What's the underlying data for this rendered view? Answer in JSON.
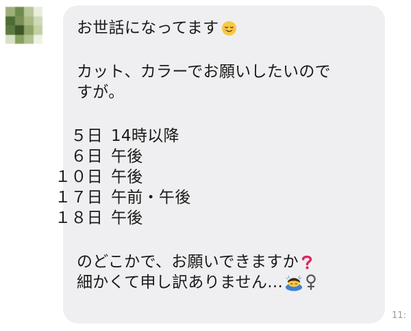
{
  "message": {
    "line1": "お世話になってます",
    "line2": "カット、カラーでお願いしたいので",
    "line3": "すが。",
    "schedule": [
      {
        "day": "  ５日",
        "time": "14時以降"
      },
      {
        "day": "  ６日",
        "time": "午後"
      },
      {
        "day": "１０日",
        "time": "午後"
      },
      {
        "day": "１７日",
        "time": "午前・午後"
      },
      {
        "day": "１８日",
        "time": "午後"
      }
    ],
    "line4": "のどこかで、お願いできますか",
    "line5": "細かくて申し訳ありません..."
  },
  "timestamp": "11:",
  "icons": {
    "smile": "relieved-face-icon",
    "question": "red-question-mark-icon",
    "bow": "person-bowing-icon",
    "female": "female-sign-icon"
  },
  "colors": {
    "bubble": "#efeff1",
    "text": "#1a1a1a",
    "question_red": "#e0245e",
    "emoji_yellow": "#f7c944"
  }
}
